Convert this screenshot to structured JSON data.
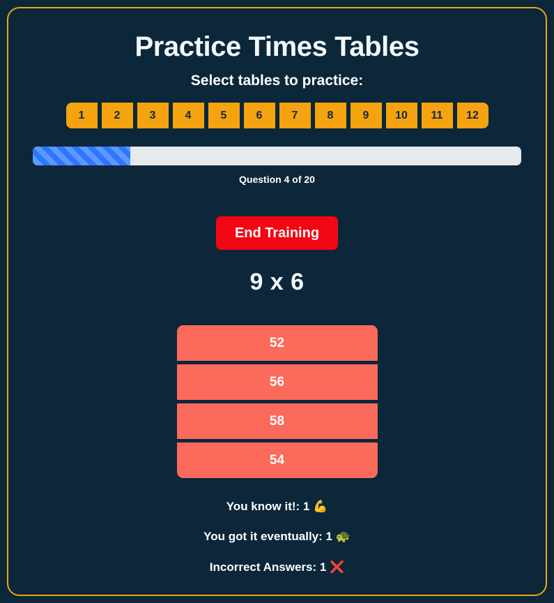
{
  "app": {
    "title": "Practice Times Tables",
    "subtitle": "Select tables to practice:",
    "colors": {
      "page_background": "#0b2739",
      "card_border": "#f5a310",
      "table_button": "#f5a310",
      "progress_fill": "#2b78ff",
      "progress_track": "#e6e9ed",
      "end_button": "#f20613",
      "answer_button": "#fb6a5a",
      "text": "#ffffff"
    }
  },
  "table_selector": {
    "buttons": [
      {
        "label": "1",
        "value": 1,
        "selected": true
      },
      {
        "label": "2",
        "value": 2,
        "selected": true
      },
      {
        "label": "3",
        "value": 3,
        "selected": true
      },
      {
        "label": "4",
        "value": 4,
        "selected": true
      },
      {
        "label": "5",
        "value": 5,
        "selected": true
      },
      {
        "label": "6",
        "value": 6,
        "selected": true
      },
      {
        "label": "7",
        "value": 7,
        "selected": true
      },
      {
        "label": "8",
        "value": 8,
        "selected": true
      },
      {
        "label": "9",
        "value": 9,
        "selected": true
      },
      {
        "label": "10",
        "value": 10,
        "selected": true
      },
      {
        "label": "11",
        "value": 11,
        "selected": true
      },
      {
        "label": "12",
        "value": 12,
        "selected": true
      }
    ]
  },
  "progress": {
    "current_question": 4,
    "total_questions": 20,
    "percent": 20,
    "label": "Question 4 of 20"
  },
  "controls": {
    "end_training_label": "End Training"
  },
  "question": {
    "text": "9 x 6",
    "left_operand": 9,
    "operator": "x",
    "right_operand": 6
  },
  "answers": {
    "options": [
      {
        "label": "52",
        "value": 52
      },
      {
        "label": "56",
        "value": 56
      },
      {
        "label": "58",
        "value": 58
      },
      {
        "label": "54",
        "value": 54
      }
    ]
  },
  "stats": {
    "lines": [
      {
        "label": "You know it!: 1",
        "emoji": "💪",
        "emoji_name": "flexed-biceps",
        "count": 1
      },
      {
        "label": "You got it eventually: 1",
        "emoji": "🐢",
        "emoji_name": "turtle",
        "count": 1
      },
      {
        "label": "Incorrect Answers: 1",
        "emoji": "❌",
        "emoji_name": "cross-mark",
        "count": 1
      }
    ]
  }
}
